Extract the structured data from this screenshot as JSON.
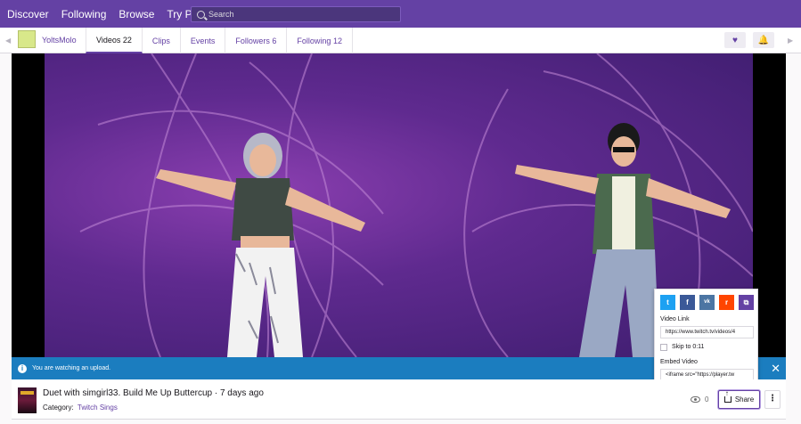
{
  "topnav": {
    "links": [
      "Discover",
      "Following",
      "Browse",
      "Try Prime"
    ],
    "more_label": "•••",
    "search_placeholder": "Search"
  },
  "channel": {
    "name": "YoltsMolo",
    "tabs": [
      {
        "label": "Videos 22",
        "active": true
      },
      {
        "label": "Clips"
      },
      {
        "label": "Events"
      },
      {
        "label": "Followers 6"
      },
      {
        "label": "Following 12"
      }
    ],
    "follow_icon": "heart-icon",
    "notify_icon": "bell-icon"
  },
  "player": {
    "banner_text": "You are watching an upload.",
    "close_label": "✕"
  },
  "share_popup": {
    "social": [
      {
        "name": "twitter-icon",
        "glyph": "t",
        "color": "#1da1f2"
      },
      {
        "name": "facebook-icon",
        "glyph": "f",
        "color": "#3b5998"
      },
      {
        "name": "vk-icon",
        "glyph": "vk",
        "color": "#4c75a3"
      },
      {
        "name": "reddit-icon",
        "glyph": "r",
        "color": "#ff4500"
      },
      {
        "name": "copy-icon",
        "glyph": "⧉",
        "color": "#6441a4"
      }
    ],
    "video_link_label": "Video Link",
    "video_link_value": "https://www.twitch.tv/videos/4",
    "skip_label": "Skip to 0:11",
    "embed_label": "Embed Video",
    "embed_value": "<iframe src=\"https://player.tw"
  },
  "video_info": {
    "title": "Duet with simgirl33. Build Me Up Buttercup · 7 days ago",
    "category_label": "Category:",
    "category_value": "Twitch Sings",
    "views": "0",
    "share_label": "Share",
    "more_label": "⋮"
  }
}
